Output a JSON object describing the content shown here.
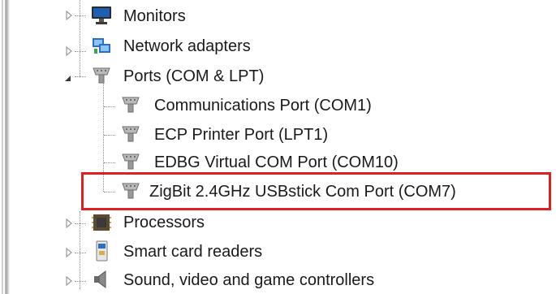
{
  "tree": {
    "monitors": {
      "label": "Monitors",
      "icon": "monitor-icon",
      "state": "collapsed"
    },
    "network_adapters": {
      "label": "Network adapters",
      "icon": "network-adapter-icon",
      "state": "collapsed"
    },
    "ports": {
      "label": "Ports (COM & LPT)",
      "icon": "port-connector-icon",
      "state": "expanded",
      "children": [
        {
          "label": "Communications Port (COM1)",
          "icon": "port-connector-icon"
        },
        {
          "label": "ECP Printer Port (LPT1)",
          "icon": "port-connector-icon"
        },
        {
          "label": "EDBG Virtual COM Port (COM10)",
          "icon": "port-connector-icon"
        },
        {
          "label": "ZigBit 2.4GHz USBstick Com Port (COM7)",
          "icon": "port-connector-icon",
          "highlighted": true
        }
      ]
    },
    "processors": {
      "label": "Processors",
      "icon": "processor-icon",
      "state": "collapsed"
    },
    "smart_card_readers": {
      "label": "Smart card readers",
      "icon": "smart-card-reader-icon",
      "state": "collapsed"
    },
    "sound": {
      "label": "Sound, video and game controllers",
      "icon": "speaker-icon",
      "state": "collapsed"
    }
  },
  "colors": {
    "highlight_border": "#e02020",
    "text": "#1a1a1a",
    "connector": "#8a8a8a"
  }
}
